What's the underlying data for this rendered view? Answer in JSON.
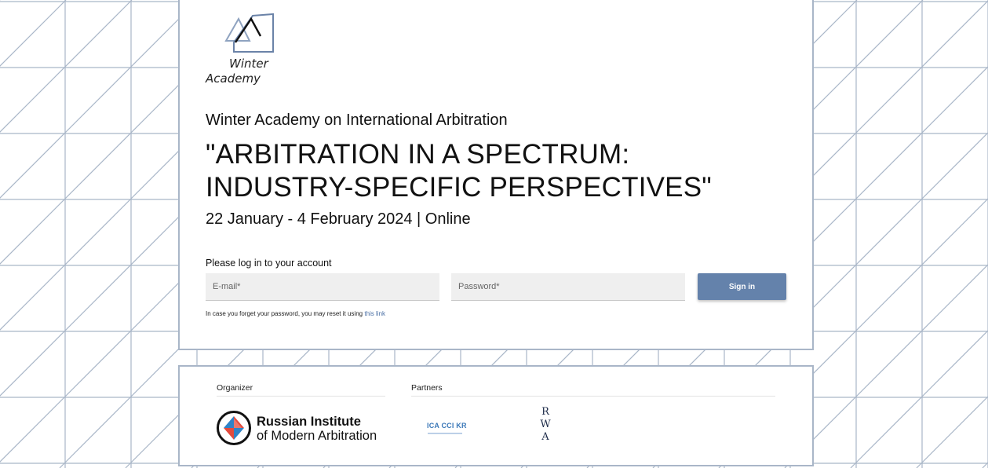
{
  "logo": {
    "line1": "Winter",
    "line2": "Academy"
  },
  "event": {
    "subtitle": "Winter Academy on International Arbitration",
    "headline_line1": "\"ARBITRATION IN A SPECTRUM:",
    "headline_line2": "INDUSTRY-SPECIFIC PERSPECTIVES\"",
    "dates": "22 January - 4 February 2024 | Online"
  },
  "login": {
    "label": "Please log in to your account",
    "email_placeholder": "E-mail*",
    "password_placeholder": "Password*",
    "signin_label": "Sign in",
    "reset_text": "In case you forget your password, you may reset it using",
    "reset_link": "this link"
  },
  "footer": {
    "organizer_label": "Organizer",
    "partners_label": "Partners",
    "organizer_name_line1": "Russian Institute",
    "organizer_name_line2": "of Modern Arbitration",
    "partner1": "ICA CCI KR",
    "partner2_letters": [
      "R",
      "W",
      "A"
    ]
  },
  "colors": {
    "accent": "#6482ab",
    "grid_line": "#a9b6c8",
    "link": "#4a6fa5"
  }
}
